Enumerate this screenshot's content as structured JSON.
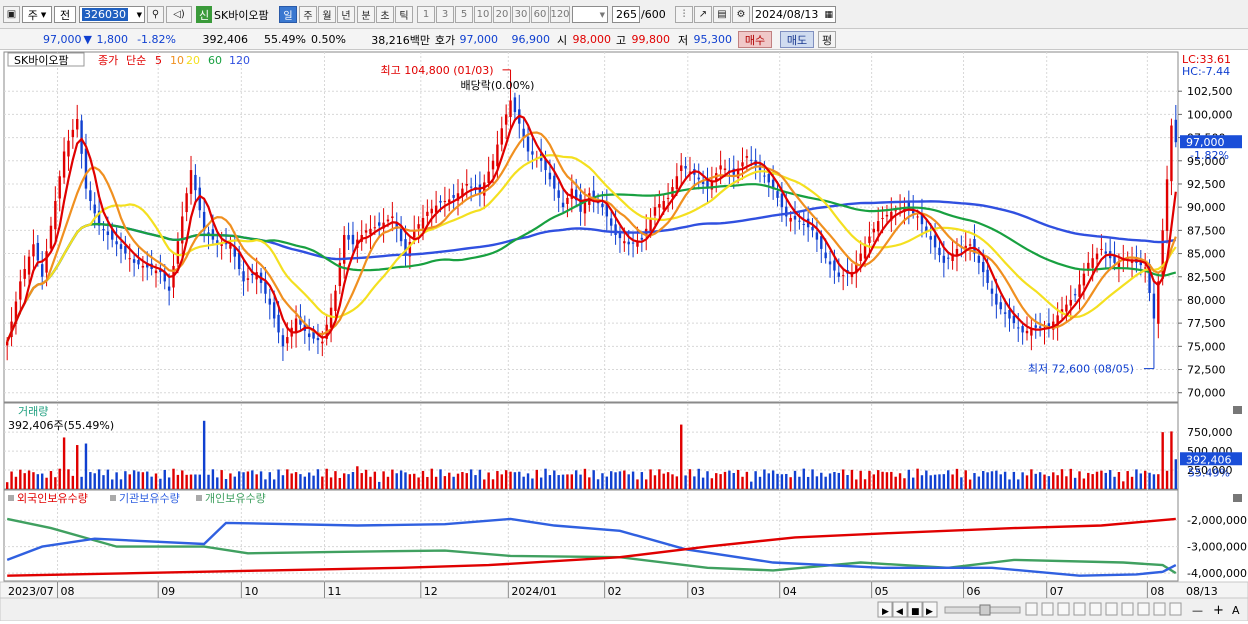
{
  "toolbar": {
    "period_type": "주",
    "prev": "전",
    "code": "326030",
    "tag_new": "신",
    "stock_name": "SK바이오팜",
    "periods": [
      "일",
      "주",
      "월",
      "년",
      "분",
      "초",
      "틱"
    ],
    "active_period": "일",
    "intervals": [
      "1",
      "3",
      "5",
      "10",
      "20",
      "30",
      "60",
      "120"
    ],
    "count": "265",
    "count_max": "/600",
    "date": "2024/08/13"
  },
  "quote": {
    "price": "97,000",
    "change": "1,800",
    "rate": "-1.82%",
    "volume": "392,406",
    "vol_ratio": "55.49%",
    "turnover": "0.50%",
    "amount": "38,216백만",
    "ask_label": "호가",
    "ask": "97,000",
    "bid": "96,900",
    "open_label": "시",
    "open": "98,000",
    "high_label": "고",
    "high": "99,800",
    "low_label": "저",
    "low": "95,300",
    "buy": "매수",
    "sell": "매도",
    "avg": "평"
  },
  "colors": {
    "up": "#e00000",
    "down": "#1040d0",
    "ma5": "#e00000",
    "ma10": "#f09020",
    "ma20": "#f4e020",
    "ma60": "#18a040",
    "ma120": "#3050e0",
    "foreign": "#e00000",
    "institution": "#3060e0",
    "individual": "#40a060",
    "price_tag": "#1a4ed8"
  },
  "chart_data": [
    {
      "type": "candlestick",
      "legend": {
        "name": "SK바이오팜",
        "close": "종가",
        "simple": "단순",
        "ma": [
          "5",
          "10",
          "20",
          "60",
          "120"
        ]
      },
      "top_right": {
        "lc": "LC:33.61",
        "hc": "HC:-7.44"
      },
      "annotations": {
        "high": "최고 104,800 (01/03)",
        "dividend": "배당락(0.00%)",
        "low": "최저 72,600 (08/05)"
      },
      "ylim": [
        69000,
        105000
      ],
      "yticks": [
        70000,
        72500,
        75000,
        77500,
        80000,
        82500,
        85000,
        87500,
        90000,
        92500,
        95000,
        97500,
        100000,
        102500
      ],
      "ytick_labels": [
        "70,000",
        "72,500",
        "75,000",
        "77,500",
        "80,000",
        "82,500",
        "85,000",
        "87,500",
        "90,000",
        "92,500",
        "95,000",
        "97,500",
        "100,000",
        "102,500"
      ],
      "current_price": 97000,
      "current_price_label": "97,000",
      "current_rate_label": "-1.82%",
      "months": [
        {
          "label": "2023/07",
          "index": 0
        },
        {
          "label": "08",
          "index": 12
        },
        {
          "label": "09",
          "index": 35
        },
        {
          "label": "10",
          "index": 54
        },
        {
          "label": "11",
          "index": 73
        },
        {
          "label": "12",
          "index": 95
        },
        {
          "label": "2024/01",
          "index": 115
        },
        {
          "label": "02",
          "index": 137
        },
        {
          "label": "03",
          "index": 156
        },
        {
          "label": "04",
          "index": 177
        },
        {
          "label": "05",
          "index": 198
        },
        {
          "label": "06",
          "index": 219
        },
        {
          "label": "07",
          "index": 238
        },
        {
          "label": "08",
          "index": 261
        }
      ],
      "last_date": "08/13",
      "close_anchors": [
        [
          0,
          75500
        ],
        [
          3,
          82000
        ],
        [
          6,
          86000
        ],
        [
          8,
          82500
        ],
        [
          10,
          88000
        ],
        [
          13,
          96000
        ],
        [
          16,
          99500
        ],
        [
          18,
          92000
        ],
        [
          21,
          88000
        ],
        [
          24,
          86500
        ],
        [
          27,
          85000
        ],
        [
          29,
          84000
        ],
        [
          32,
          83500
        ],
        [
          35,
          83000
        ],
        [
          37,
          81000
        ],
        [
          40,
          89000
        ],
        [
          42,
          94000
        ],
        [
          45,
          87500
        ],
        [
          48,
          86000
        ],
        [
          51,
          86000
        ],
        [
          54,
          82000
        ],
        [
          57,
          83000
        ],
        [
          60,
          79500
        ],
        [
          63,
          75000
        ],
        [
          66,
          78000
        ],
        [
          69,
          76000
        ],
        [
          72,
          75500
        ],
        [
          75,
          81000
        ],
        [
          77,
          87000
        ],
        [
          79,
          86000
        ],
        [
          82,
          87500
        ],
        [
          85,
          88000
        ],
        [
          88,
          89000
        ],
        [
          91,
          85000
        ],
        [
          93,
          87500
        ],
        [
          96,
          89500
        ],
        [
          99,
          90500
        ],
        [
          102,
          91000
        ],
        [
          105,
          92500
        ],
        [
          108,
          91500
        ],
        [
          111,
          95000
        ],
        [
          113,
          98500
        ],
        [
          115,
          101500
        ],
        [
          117,
          99000
        ],
        [
          119,
          96000
        ],
        [
          122,
          95000
        ],
        [
          125,
          92000
        ],
        [
          127,
          90000
        ],
        [
          129,
          92000
        ],
        [
          131,
          89500
        ],
        [
          133,
          91500
        ],
        [
          136,
          90000
        ],
        [
          139,
          87000
        ],
        [
          142,
          86000
        ],
        [
          145,
          86500
        ],
        [
          148,
          90000
        ],
        [
          151,
          91000
        ],
        [
          154,
          94500
        ],
        [
          157,
          93500
        ],
        [
          160,
          92000
        ],
        [
          163,
          94500
        ],
        [
          166,
          93500
        ],
        [
          169,
          95500
        ],
        [
          172,
          94000
        ],
        [
          175,
          92000
        ],
        [
          178,
          89000
        ],
        [
          181,
          88500
        ],
        [
          184,
          87500
        ],
        [
          187,
          84500
        ],
        [
          190,
          82500
        ],
        [
          193,
          83000
        ],
        [
          196,
          86000
        ],
        [
          199,
          88500
        ],
        [
          202,
          89500
        ],
        [
          205,
          90000
        ],
        [
          208,
          89000
        ],
        [
          211,
          86500
        ],
        [
          214,
          84000
        ],
        [
          217,
          85500
        ],
        [
          220,
          86000
        ],
        [
          223,
          83000
        ],
        [
          226,
          79500
        ],
        [
          229,
          78000
        ],
        [
          232,
          76500
        ],
        [
          235,
          77000
        ],
        [
          238,
          77000
        ],
        [
          241,
          79000
        ],
        [
          244,
          80500
        ],
        [
          247,
          84000
        ],
        [
          250,
          85500
        ],
        [
          253,
          84000
        ],
        [
          256,
          84500
        ],
        [
          258,
          84000
        ],
        [
          260,
          83500
        ],
        [
          262,
          78000
        ],
        [
          263,
          82000
        ],
        [
          264,
          87500
        ],
        [
          265,
          93000
        ],
        [
          266,
          98800
        ],
        [
          267,
          97000
        ]
      ],
      "volume": {
        "title": "거래량",
        "current_label": "392,406주(55.49%)",
        "ylim": [
          0,
          950000
        ],
        "yticks": [
          250000,
          500000,
          750000
        ],
        "ytick_labels": [
          "250,000",
          "500,000",
          "750,000"
        ],
        "current_value": 392406,
        "current_value_label": "392,406",
        "current_ratio_label": "55.49%",
        "spikes": [
          [
            13,
            680000
          ],
          [
            16,
            580000
          ],
          [
            18,
            600000
          ],
          [
            45,
            900000
          ],
          [
            47,
            260000
          ],
          [
            80,
            300000
          ],
          [
            154,
            850000
          ],
          [
            176,
            200000
          ],
          [
            195,
            240000
          ],
          [
            232,
            220000
          ],
          [
            260,
            240000
          ],
          [
            264,
            750000
          ],
          [
            266,
            760000
          ]
        ]
      },
      "holdings": {
        "series_names": [
          "외국인보유수량",
          "기관보유수량",
          "개인보유수량"
        ],
        "ylim": [
          -4300000,
          -1500000
        ],
        "yticks": [
          -2000000,
          -3000000,
          -4000000
        ],
        "ytick_labels": [
          "-2,000,000",
          "-3,000,000",
          "-4,000,000"
        ],
        "foreign": [
          [
            0,
            -4100000
          ],
          [
            30,
            -4000000
          ],
          [
            60,
            -3900000
          ],
          [
            90,
            -3800000
          ],
          [
            110,
            -3700000
          ],
          [
            140,
            -3400000
          ],
          [
            160,
            -3000000
          ],
          [
            180,
            -2650000
          ],
          [
            200,
            -2500000
          ],
          [
            230,
            -2300000
          ],
          [
            250,
            -2200000
          ],
          [
            267,
            -1950000
          ]
        ],
        "institution": [
          [
            0,
            -3500000
          ],
          [
            8,
            -3000000
          ],
          [
            20,
            -2700000
          ],
          [
            45,
            -2900000
          ],
          [
            50,
            -2100000
          ],
          [
            80,
            -2200000
          ],
          [
            100,
            -2150000
          ],
          [
            115,
            -1950000
          ],
          [
            125,
            -2200000
          ],
          [
            140,
            -2400000
          ],
          [
            155,
            -3100000
          ],
          [
            175,
            -3600000
          ],
          [
            200,
            -3800000
          ],
          [
            225,
            -3800000
          ],
          [
            245,
            -4100000
          ],
          [
            258,
            -4050000
          ],
          [
            264,
            -3950000
          ],
          [
            267,
            -3700000
          ]
        ],
        "individual": [
          [
            0,
            -1950000
          ],
          [
            10,
            -2300000
          ],
          [
            25,
            -3000000
          ],
          [
            45,
            -3000000
          ],
          [
            55,
            -3250000
          ],
          [
            75,
            -3200000
          ],
          [
            100,
            -3150000
          ],
          [
            115,
            -3350000
          ],
          [
            140,
            -3400000
          ],
          [
            160,
            -3800000
          ],
          [
            175,
            -3900000
          ],
          [
            195,
            -3600000
          ],
          [
            215,
            -3800000
          ],
          [
            230,
            -3500000
          ],
          [
            255,
            -3600000
          ],
          [
            264,
            -3700000
          ],
          [
            267,
            -4000000
          ]
        ]
      }
    }
  ]
}
